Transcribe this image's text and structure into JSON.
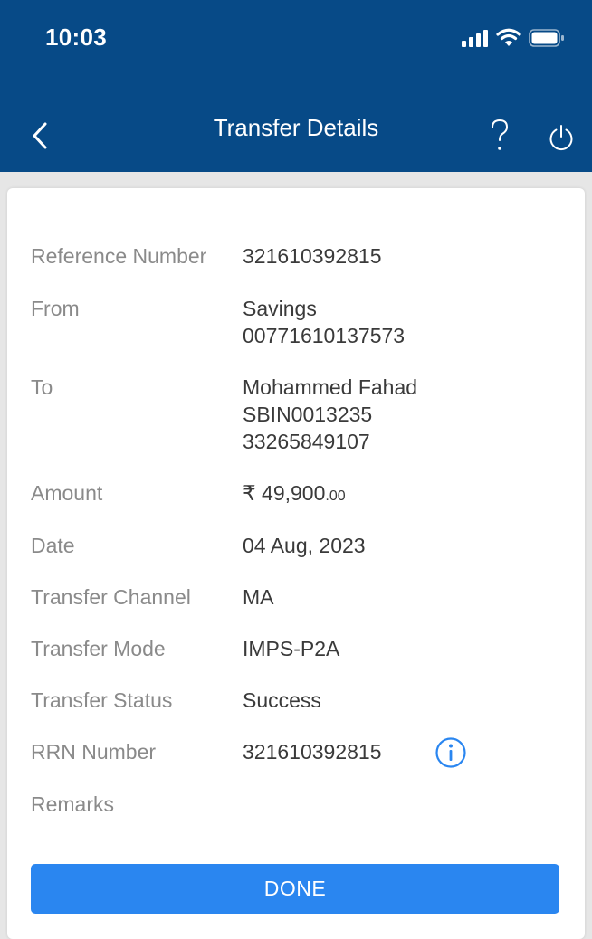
{
  "status_bar": {
    "time": "10:03"
  },
  "nav": {
    "title": "Transfer Details",
    "help_icon": "question-icon",
    "logout_icon": "power-icon",
    "back_icon": "chevron-left-icon"
  },
  "details": {
    "reference": {
      "label": "Reference Number",
      "value": "321610392815"
    },
    "from": {
      "label": "From",
      "line1": "Savings",
      "line2": "00771610137573"
    },
    "to": {
      "label": "To",
      "line1": "Mohammed Fahad",
      "line2": "SBIN0013235",
      "line3": "33265849107"
    },
    "amount": {
      "label": "Amount",
      "value": "₹ 49,900",
      "paise": ".00"
    },
    "date": {
      "label": "Date",
      "value": "04 Aug, 2023"
    },
    "channel": {
      "label": "Transfer Channel",
      "value": "MA"
    },
    "mode": {
      "label": "Transfer Mode",
      "value": "IMPS-P2A"
    },
    "status": {
      "label": "Transfer Status",
      "value": "Success"
    },
    "rrn": {
      "label": "RRN Number",
      "value": "321610392815"
    },
    "remarks": {
      "label": "Remarks",
      "value": ""
    }
  },
  "done_button": {
    "label": "DONE"
  },
  "colors": {
    "header": "#074a87",
    "accent": "#2a86f0",
    "label": "#8a8a8a",
    "value": "#3a3a3a"
  }
}
